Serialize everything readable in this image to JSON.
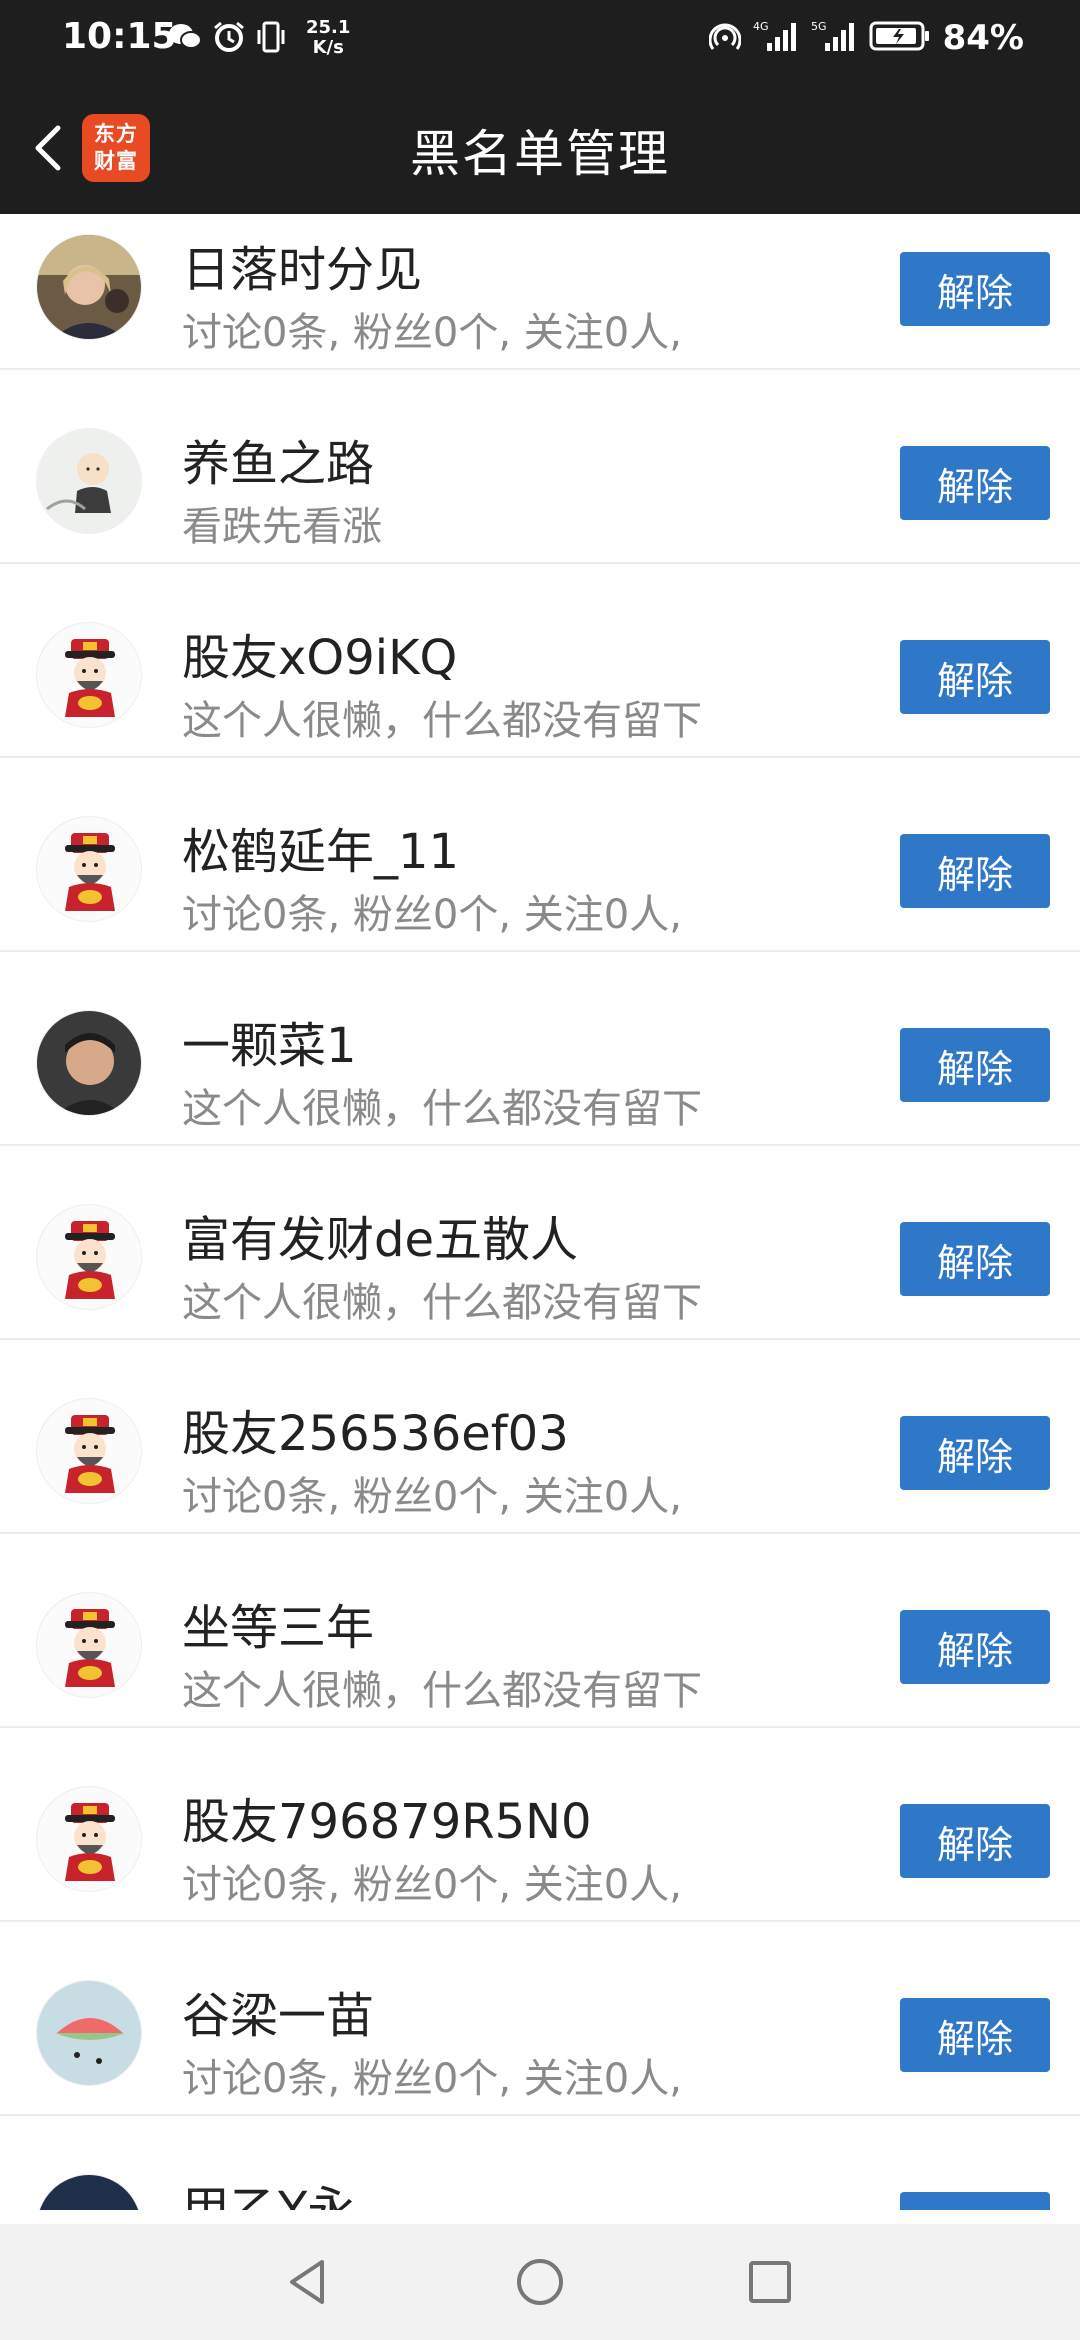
{
  "status_bar": {
    "time": "10:15",
    "net_speed_value": "25.1",
    "net_speed_unit": "K/s",
    "battery": "84%",
    "icons": [
      "wechat-icon",
      "alarm-icon",
      "vibrate-icon",
      "hotspot-icon",
      "signal-4g-icon",
      "signal-5g-icon",
      "battery-icon"
    ]
  },
  "header": {
    "title": "黑名单管理",
    "logo_line1": "东方",
    "logo_line2": "财富",
    "logo_color": "#e84b24"
  },
  "unblock_label": "解除",
  "accent_color": "#2f78c8",
  "users": [
    {
      "name": "日落时分见",
      "desc": "讨论0条, 粉丝0个, 关注0人,",
      "avatar": "photo-woman"
    },
    {
      "name": "养鱼之路",
      "desc": "看跌先看涨",
      "avatar": "cartoon-monk"
    },
    {
      "name": "股友xO9iKQ",
      "desc": "这个人很懒，什么都没有留下",
      "avatar": "caishen"
    },
    {
      "name": "松鹤延年_11",
      "desc": "讨论0条, 粉丝0个, 关注0人,",
      "avatar": "caishen"
    },
    {
      "name": "一颗菜1",
      "desc": "这个人很懒，什么都没有留下",
      "avatar": "photo-man"
    },
    {
      "name": "富有发财de五散人",
      "desc": "这个人很懒，什么都没有留下",
      "avatar": "caishen"
    },
    {
      "name": "股友256536ef03",
      "desc": "讨论0条, 粉丝0个, 关注0人,",
      "avatar": "caishen"
    },
    {
      "name": "坐等三年",
      "desc": "这个人很懒，什么都没有留下",
      "avatar": "caishen"
    },
    {
      "name": "股友796879R5N0",
      "desc": "讨论0条, 粉丝0个, 关注0人,",
      "avatar": "caishen"
    },
    {
      "name": "谷梁一苗",
      "desc": "讨论0条, 粉丝0个, 关注0人,",
      "avatar": "photo-watermelon"
    },
    {
      "name": "甲乙Y永",
      "desc": "",
      "avatar": "photo-dark"
    }
  ],
  "nav": {
    "icons": [
      "back-triangle-icon",
      "home-circle-icon",
      "recents-square-icon"
    ]
  }
}
